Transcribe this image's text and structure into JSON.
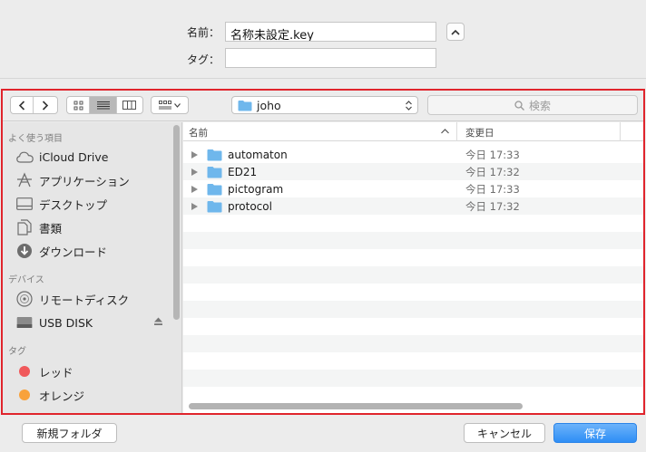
{
  "name_panel": {
    "name_label": "名前：",
    "name_value": "名称未設定.key",
    "tags_label": "タグ：",
    "tags_value": ""
  },
  "toolbar": {
    "location": "joho",
    "search_placeholder": "検索"
  },
  "sidebar": {
    "favorites_header": "よく使う項目",
    "favorites": [
      {
        "label": "iCloud Drive",
        "icon": "cloud-icon"
      },
      {
        "label": "アプリケーション",
        "icon": "applications-icon"
      },
      {
        "label": "デスクトップ",
        "icon": "desktop-icon"
      },
      {
        "label": "書類",
        "icon": "documents-icon"
      },
      {
        "label": "ダウンロード",
        "icon": "download-icon"
      }
    ],
    "devices_header": "デバイス",
    "devices": [
      {
        "label": "リモートディスク",
        "icon": "disc-icon"
      },
      {
        "label": "USB DISK",
        "icon": "drive-icon"
      }
    ],
    "tags_header": "タグ",
    "tags": [
      {
        "label": "レッド",
        "color": "#f0595b"
      },
      {
        "label": "オレンジ",
        "color": "#f8a23c"
      }
    ]
  },
  "file_list": {
    "col_name": "名前",
    "col_modified": "変更日",
    "rows": [
      {
        "name": "automaton",
        "modified": "今日 17:33"
      },
      {
        "name": "ED21",
        "modified": "今日 17:32"
      },
      {
        "name": "pictogram",
        "modified": "今日 17:33"
      },
      {
        "name": "protocol",
        "modified": "今日 17:32"
      }
    ]
  },
  "buttons": {
    "new_folder": "新規フォルダ",
    "cancel": "キャンセル",
    "save": "保存"
  },
  "colors": {
    "highlight_border": "#e0242c",
    "folder": "#6fb7ec",
    "primary": "#2e8ef5"
  }
}
